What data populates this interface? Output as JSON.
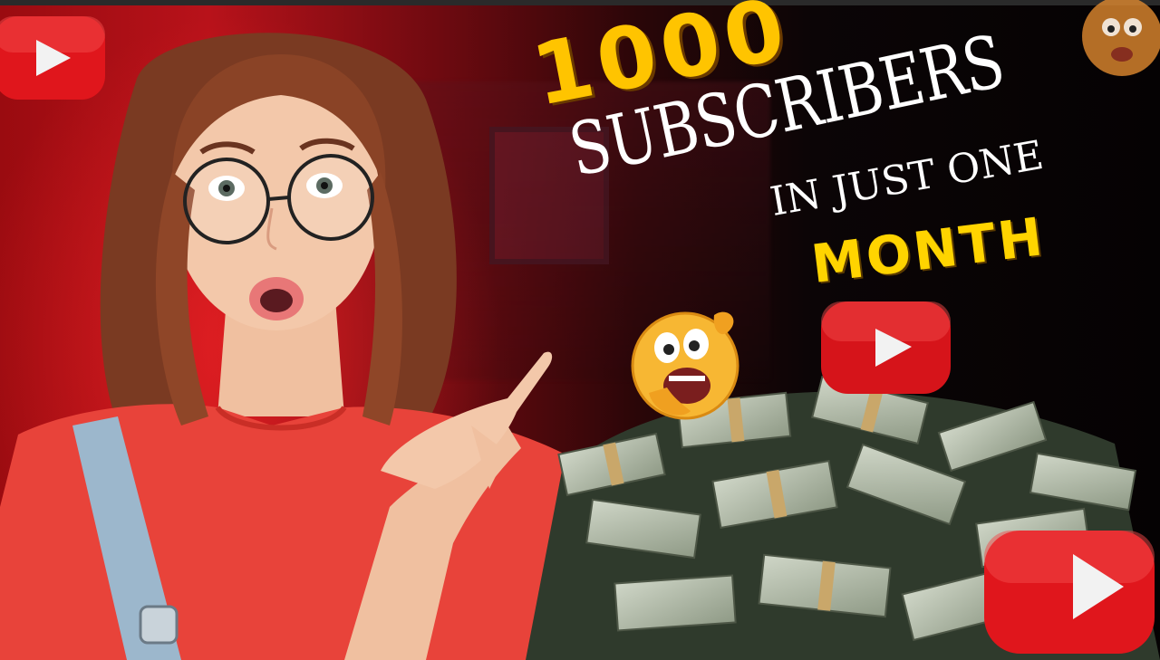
{
  "headline": {
    "number": "1000",
    "line1": "SUBSCRIBERS",
    "line2": "IN JUST ONE",
    "line3": "MONTH"
  },
  "colors": {
    "accent_yellow": "#ffc400",
    "youtube_red": "#e0161c",
    "background_red": "#b8121a",
    "text_white": "#ffffff"
  },
  "icons": [
    "youtube-play-icon",
    "shocked-emoji-icon",
    "money-stack-icon"
  ]
}
